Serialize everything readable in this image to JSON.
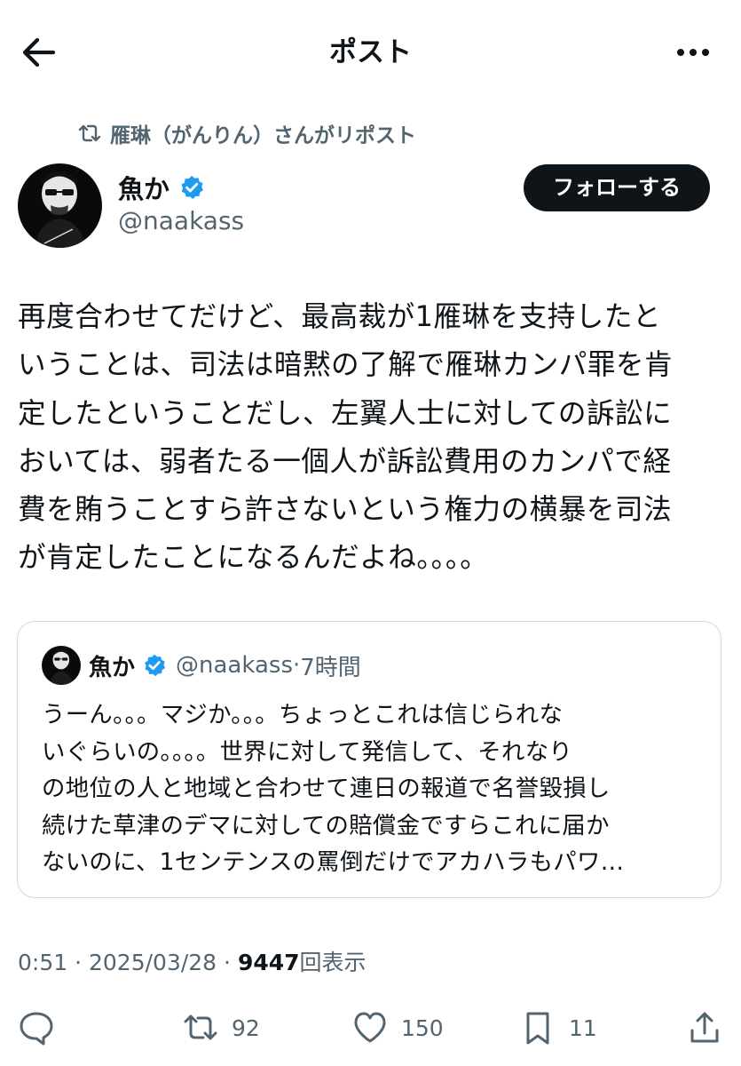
{
  "header": {
    "title": "ポスト"
  },
  "repost": {
    "text": "雁琳（がんりん）さんがリポスト"
  },
  "author": {
    "name": "魚か",
    "handle": "@naakass"
  },
  "follow": {
    "label": "フォローする"
  },
  "post": {
    "text": "再度合わせてだけど、最高裁が1雁琳を支持したと\nいうことは、司法は暗黙の了解で雁琳カンパ罪を肯\n定したということだし、左翼人士に対しての訴訟に\nおいては、弱者たる一個人が訴訟費用のカンパで経\n費を賄うことすら許さないという権力の横暴を司法\nが肯定したことになるんだよね。。。。"
  },
  "quote": {
    "name": "魚か",
    "handle": "@naakass",
    "dot": "·",
    "time": "7時間",
    "text": "うーん。。。マジか。。。ちょっとこれは信じられな\nいぐらいの。。。。世界に対して発信して、それなり\nの地位の人と地域と合わせて連日の報道で名誉毀損し\n続けた草津のデマに対しての賠償金ですらこれに届か\nないのに、1センテンスの罵倒だけでアカハラもパワ…"
  },
  "meta": {
    "time": "0:51",
    "sep": "·",
    "date": "2025/03/28",
    "views_count": "9447",
    "views_label": "回表示"
  },
  "actions": {
    "reposts": "92",
    "likes": "150",
    "bookmarks": "11"
  },
  "colors": {
    "text": "#0f1419",
    "muted": "#536471",
    "verified": "#1d9bf0",
    "border": "#cfd9de"
  }
}
